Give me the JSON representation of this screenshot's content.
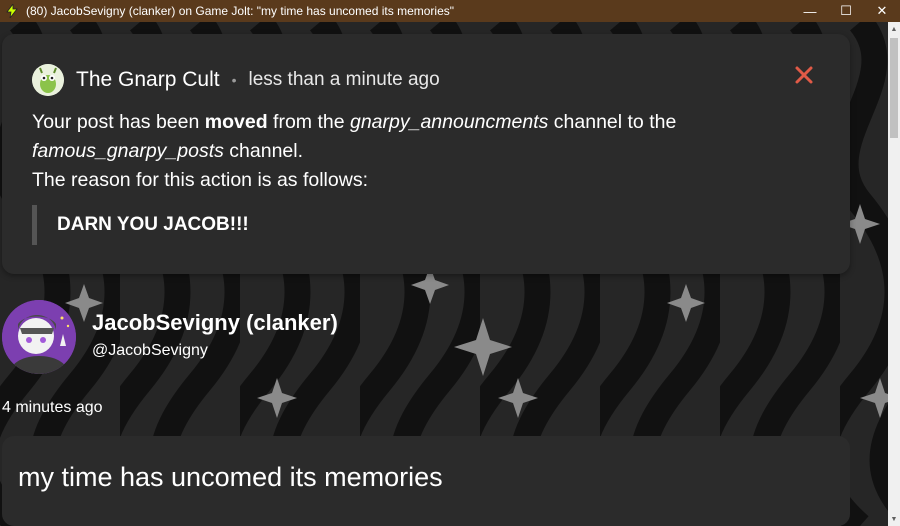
{
  "window": {
    "title": "(80) JacobSevigny (clanker) on Game Jolt: \"my time has uncomed its memories\"",
    "minimize": "—",
    "maximize": "☐",
    "close": "✕",
    "app_icon": "gamejolt-bolt-icon"
  },
  "notification": {
    "community": "The Gnarp Cult",
    "separator": "•",
    "time": "less than a minute ago",
    "close_icon": "close-icon",
    "close_color": "#e05a47",
    "body": {
      "p1_a": "Your post has been ",
      "p1_bold": "moved",
      "p1_b": " from the ",
      "from_channel": "gnarpy_announcments",
      "p1_c": " channel to the",
      "to_channel": "famous_gnarpy_posts",
      "p1_d": " channel.",
      "p2": "The reason for this action is as follows:"
    },
    "reason": "DARN YOU JACOB!!!"
  },
  "post": {
    "author_name": "JacobSevigny (clanker)",
    "author_handle": "@JacobSevigny",
    "time": "4 minutes ago",
    "text": "my time has uncomed its memories"
  },
  "colors": {
    "titlebar": "#5a3a1c",
    "card": "#2b2b2b",
    "background": "#1b1b1b"
  }
}
